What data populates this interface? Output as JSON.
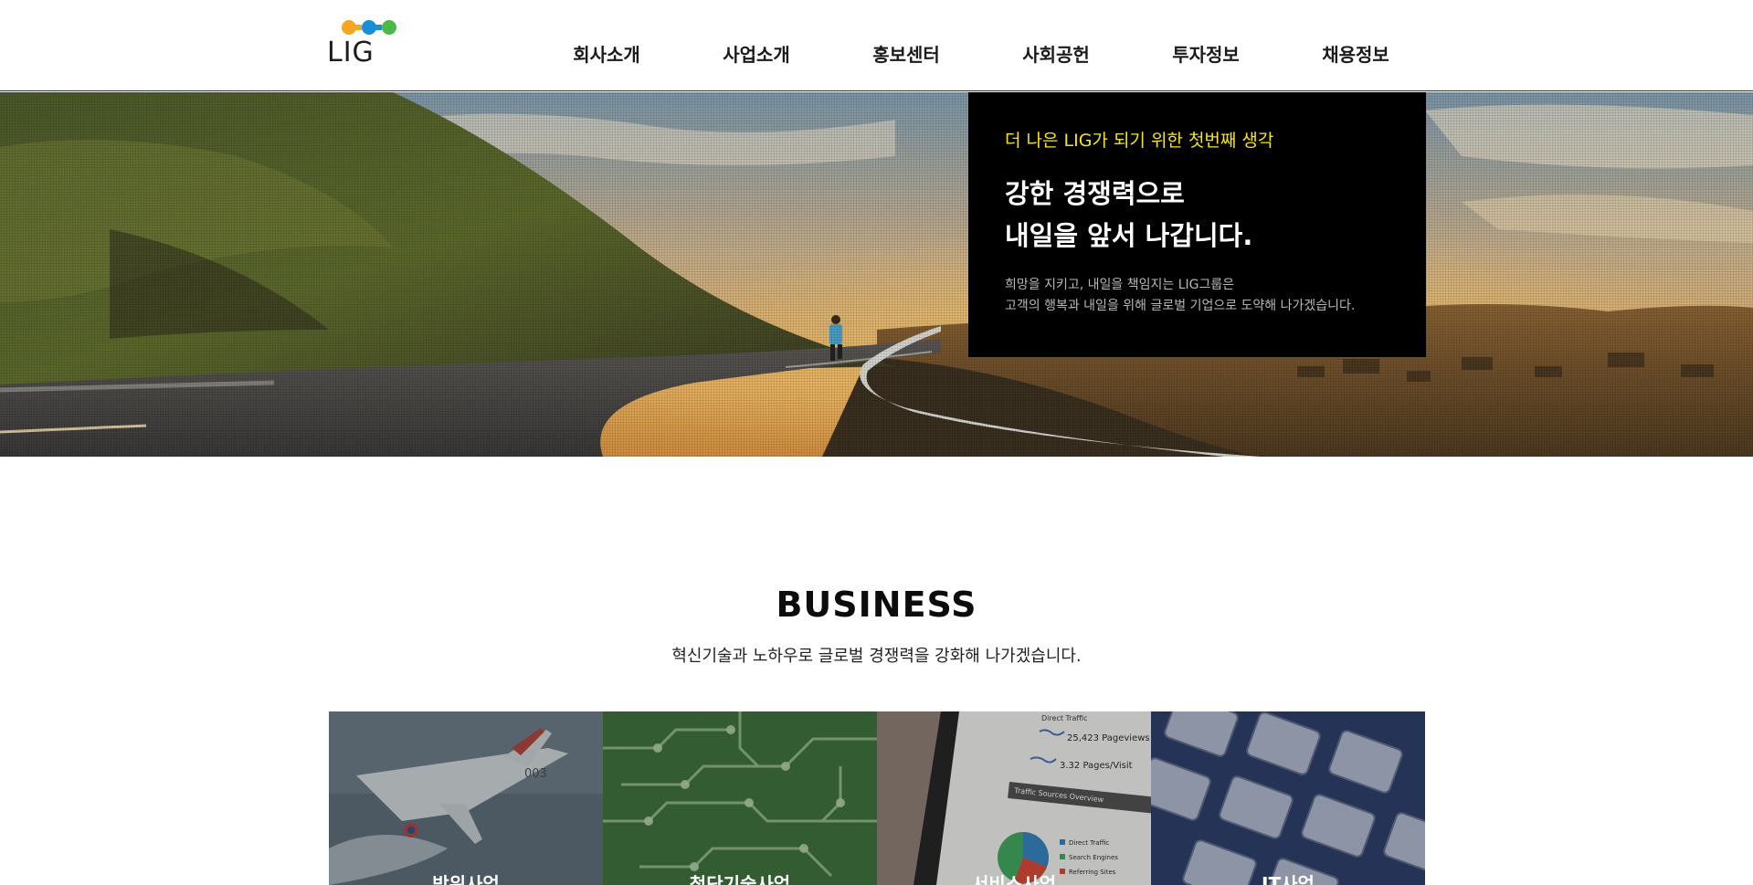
{
  "header": {
    "logo_text": "LIG",
    "nav": [
      "회사소개",
      "사업소개",
      "홍보센터",
      "사회공헌",
      "투자정보",
      "채용정보"
    ]
  },
  "hero": {
    "eyebrow": "더 나은 LIG가 되기 위한 첫번째 생각",
    "title_lines": [
      "강한 경쟁력으로",
      "내일을 앞서 나갑니다."
    ],
    "desc_lines": [
      "희망을 지키고, 내일을 책임지는 LIG그룹은",
      "고객의 행복과 내일을 위해 글로벌 기업으로 도약해 나가겠습니다."
    ],
    "image": "runner-on-hillside-road-at-sunset"
  },
  "business": {
    "title": "BUSINESS",
    "subtitle": "혁신기술과 노하우로 글로벌 경쟁력을 강화해 나가겠습니다.",
    "cards": [
      {
        "label": "방위사업",
        "image": "fighter-jet",
        "figure_text": "003"
      },
      {
        "label": "첨단기술사업",
        "image": "circuit-board"
      },
      {
        "label": "서비스사업",
        "image": "analytics-tablet",
        "figure_text": [
          "25,423 Pageviews",
          "3.32 Pages/Visit",
          "Traffic Sources Overview",
          "Direct Traffic",
          "Search Engines",
          "Referring Sites"
        ]
      },
      {
        "label": "IT사업",
        "image": "keyboard"
      }
    ]
  },
  "colors": {
    "accent_yellow": "#f4e61b",
    "hero_box": "#000000",
    "logo_orange": "#f5a623",
    "logo_blue": "#1a8fd9",
    "logo_green": "#4cb848"
  }
}
